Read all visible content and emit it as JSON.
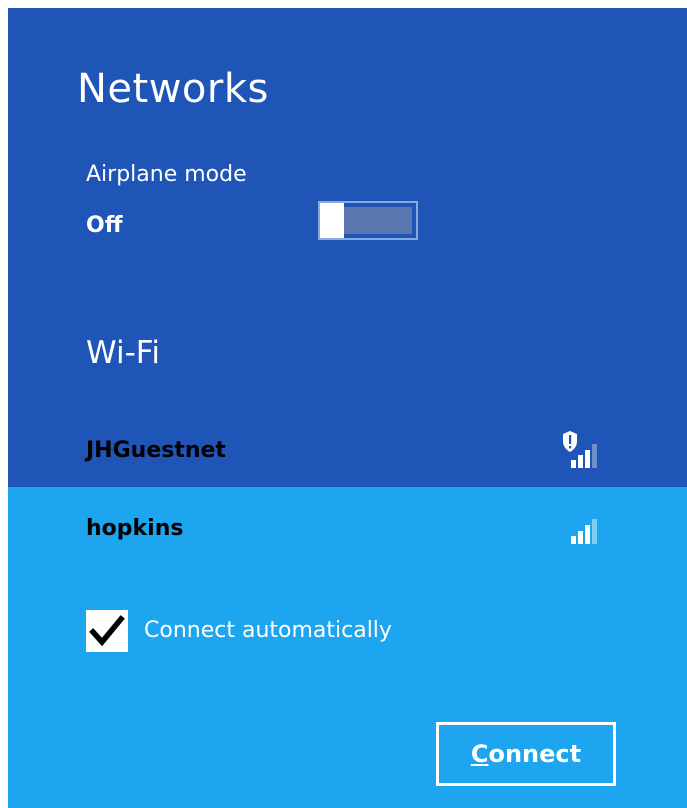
{
  "header": {
    "title": "Networks"
  },
  "airplane": {
    "label": "Airplane mode",
    "state": "Off",
    "enabled": false
  },
  "wifi": {
    "section_label": "Wi-Fi",
    "networks": [
      {
        "name": "JHGuestnet",
        "icon": "signal-warning-icon",
        "signal_bars": 4,
        "secured": false
      },
      {
        "name": "hopkins",
        "icon": "signal-icon",
        "signal_bars": 4,
        "selected": true
      }
    ]
  },
  "connect_auto": {
    "label": "Connect automatically",
    "checked": true
  },
  "connect_button": {
    "mnemonic": "C",
    "rest": "onnect"
  },
  "colors": {
    "panel": "#1f55b6",
    "selected": "#1ea5ef",
    "text": "#ffffff"
  }
}
